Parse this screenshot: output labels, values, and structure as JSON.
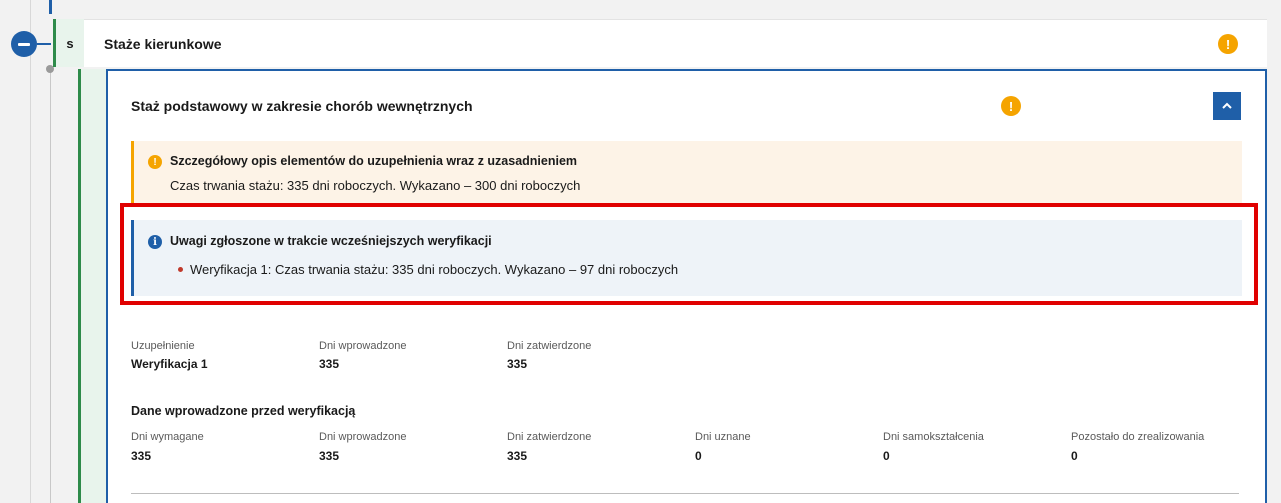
{
  "section": {
    "badge": "s",
    "title": "Staże kierunkowe"
  },
  "card": {
    "title": "Staż podstawowy w zakresie chorób wewnętrznych",
    "warning_alert": {
      "heading": "Szczegółowy opis elementów do uzupełnienia wraz z uzasadnieniem",
      "body": "Czas trwania stażu: 335 dni roboczych. Wykazano – 300 dni roboczych"
    },
    "info_alert": {
      "heading": "Uwagi zgłoszone w trakcie wcześniejszych weryfikacji",
      "items": [
        "Weryfikacja 1: Czas trwania stażu: 335 dni roboczych. Wykazano – 97 dni roboczych"
      ]
    },
    "summary": {
      "fields": [
        {
          "label": "Uzupełnienie",
          "value": "Weryfikacja 1"
        },
        {
          "label": "Dni wprowadzone",
          "value": "335"
        },
        {
          "label": "Dni zatwierdzone",
          "value": "335"
        }
      ]
    },
    "before_verification": {
      "heading": "Dane wprowadzone przed weryfikacją",
      "fields": [
        {
          "label": "Dni wymagane",
          "value": "335"
        },
        {
          "label": "Dni wprowadzone",
          "value": "335"
        },
        {
          "label": "Dni zatwierdzone",
          "value": "335"
        },
        {
          "label": "Dni uznane",
          "value": "0"
        },
        {
          "label": "Dni samokształcenia",
          "value": "0"
        },
        {
          "label": "Pozostało do zrealizowania",
          "value": "0"
        }
      ]
    }
  },
  "icons": {
    "warning": "!",
    "info": "i"
  },
  "colors": {
    "primary": "#1f5fa8",
    "warning": "#f5a400",
    "success": "#2e8b4a",
    "highlight": "#e00000"
  }
}
